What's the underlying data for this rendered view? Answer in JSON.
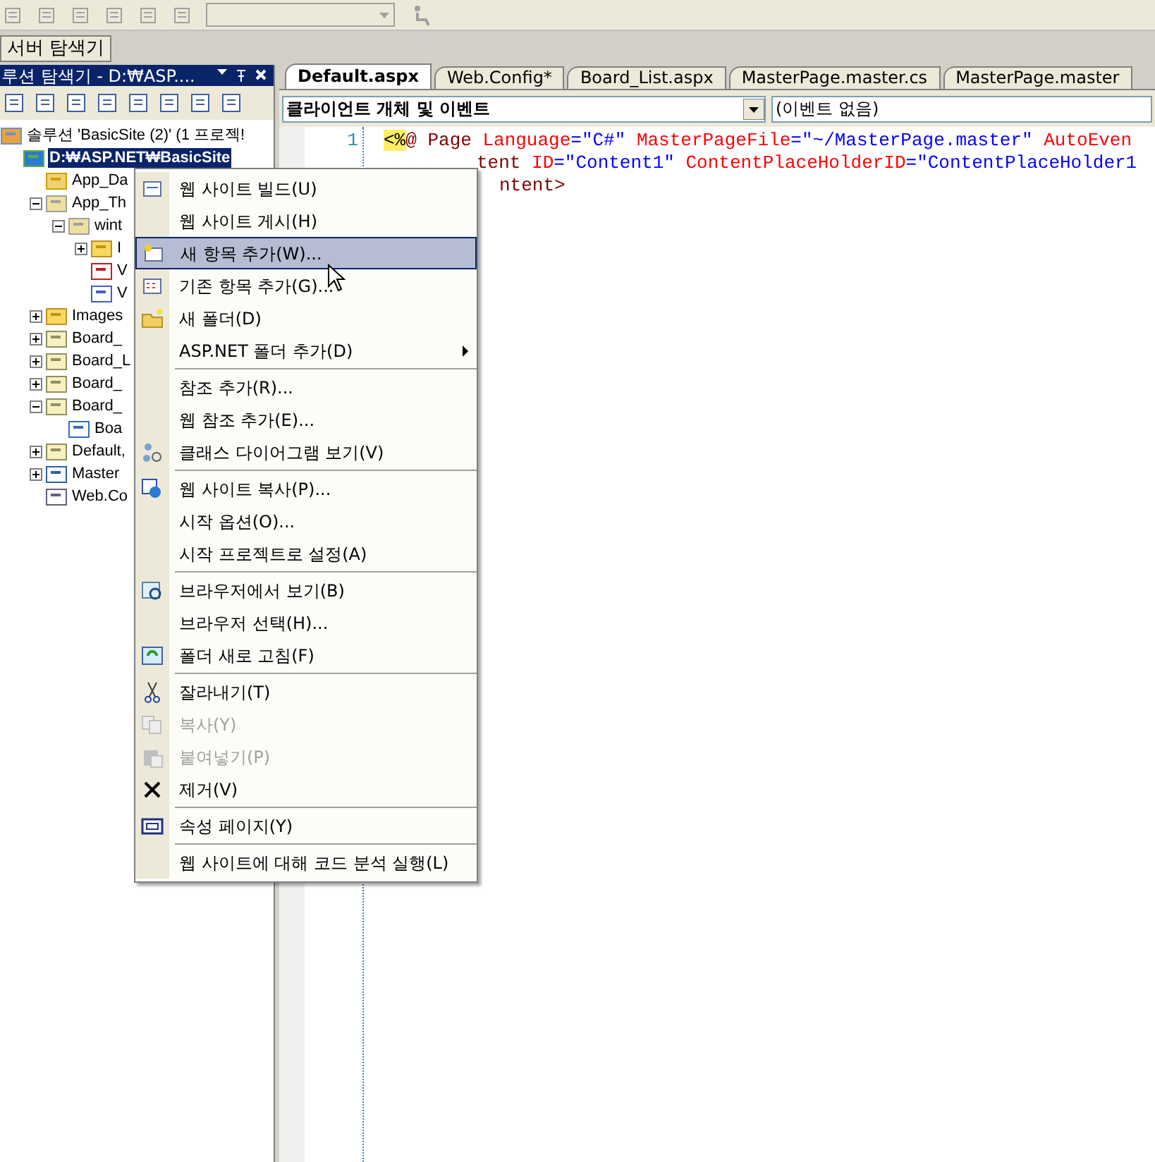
{
  "server_explorer_tab": {
    "label": "서버 탐색기"
  },
  "solution_explorer": {
    "title": "루션 탐색기 - D:₩ASP....",
    "tree": [
      {
        "label": "솔루션 'BasicSite (2)' (1 프로젝!",
        "kind": "solution",
        "selected": false,
        "children": [
          {
            "label": "D:₩ASP.NET₩BasicSite",
            "kind": "web",
            "selected": true,
            "children": [
              {
                "label": "App_Da",
                "kind": "datafolder",
                "selected": false
              },
              {
                "label": "App_Th",
                "kind": "openfolder",
                "selected": false,
                "expanded": true,
                "children": [
                  {
                    "label": "wint",
                    "kind": "openfolder",
                    "selected": false,
                    "expanded": true,
                    "children": [
                      {
                        "label": "I",
                        "kind": "folder",
                        "selected": false,
                        "expanded": false
                      },
                      {
                        "label": "V",
                        "kind": "skin",
                        "selected": false
                      },
                      {
                        "label": "V",
                        "kind": "css",
                        "selected": false
                      }
                    ]
                  }
                ]
              },
              {
                "label": "Images",
                "kind": "folder",
                "selected": false,
                "expanded": false
              },
              {
                "label": "Board_",
                "kind": "page",
                "selected": false,
                "expanded": false
              },
              {
                "label": "Board_L",
                "kind": "page",
                "selected": false,
                "expanded": false
              },
              {
                "label": "Board_",
                "kind": "page",
                "selected": false,
                "expanded": false
              },
              {
                "label": "Board_",
                "kind": "page",
                "selected": false,
                "expanded": true,
                "children": [
                  {
                    "label": "Boa",
                    "kind": "code",
                    "selected": false
                  }
                ]
              },
              {
                "label": "Default,",
                "kind": "page",
                "selected": false,
                "expanded": false
              },
              {
                "label": "Master",
                "kind": "master",
                "selected": false,
                "expanded": false
              },
              {
                "label": "Web.Co",
                "kind": "config",
                "selected": false
              }
            ]
          }
        ]
      }
    ]
  },
  "editor": {
    "tabs": [
      {
        "label": "Default.aspx",
        "selected": true
      },
      {
        "label": "Web.Config*",
        "selected": false
      },
      {
        "label": "Board_List.aspx",
        "selected": false
      },
      {
        "label": "MasterPage.master.cs",
        "selected": false
      },
      {
        "label": "MasterPage.master",
        "selected": false
      }
    ],
    "object_dropdown": {
      "value": "클라이언트 개체 및 이벤트"
    },
    "event_dropdown": {
      "value": "(이벤트 없음)"
    },
    "lines": [
      {
        "number": "1",
        "tokens": [
          {
            "kind": "delim",
            "text": "<%"
          },
          {
            "kind": "tag",
            "text": "@ Page "
          },
          {
            "kind": "attr",
            "text": "Language"
          },
          {
            "kind": "value",
            "text": "=\"C#\" "
          },
          {
            "kind": "attr",
            "text": "MasterPageFile"
          },
          {
            "kind": "value",
            "text": "=\"~/MasterPage.master\" "
          },
          {
            "kind": "attr",
            "text": "AutoEven"
          }
        ]
      },
      {
        "tokens": [
          {
            "kind": "tag",
            "text": "tent "
          },
          {
            "kind": "attr",
            "text": "ID"
          },
          {
            "kind": "value",
            "text": "=\"Content1\" "
          },
          {
            "kind": "attr",
            "text": "ContentPlaceHolderID"
          },
          {
            "kind": "value",
            "text": "=\"ContentPlaceHolder1"
          }
        ]
      },
      {
        "tokens": [
          {
            "kind": "tag",
            "text": "ntent>"
          }
        ]
      }
    ]
  },
  "context_menu": {
    "items": [
      {
        "kind": "item",
        "label": "웹 사이트 빌드(U)",
        "selected": false,
        "disabled": false
      },
      {
        "kind": "item",
        "label": "웹 사이트 게시(H)",
        "selected": false,
        "disabled": false
      },
      {
        "kind": "item",
        "label": "새 항목 추가(W)...",
        "selected": true,
        "disabled": false
      },
      {
        "kind": "item",
        "label": "기존 항목 추가(G)...",
        "selected": false,
        "disabled": false
      },
      {
        "kind": "item",
        "label": "새 폴더(D)",
        "selected": false,
        "disabled": false
      },
      {
        "kind": "item",
        "label": "ASP.NET 폴더 추가(D)",
        "selected": false,
        "disabled": false,
        "submenu": true
      },
      {
        "kind": "separator"
      },
      {
        "kind": "item",
        "label": "참조 추가(R)...",
        "selected": false,
        "disabled": false
      },
      {
        "kind": "item",
        "label": "웹 참조 추가(E)...",
        "selected": false,
        "disabled": false
      },
      {
        "kind": "item",
        "label": "클래스 다이어그램 보기(V)",
        "selected": false,
        "disabled": false
      },
      {
        "kind": "separator"
      },
      {
        "kind": "item",
        "label": "웹 사이트 복사(P)...",
        "selected": false,
        "disabled": false
      },
      {
        "kind": "item",
        "label": "시작 옵션(O)...",
        "selected": false,
        "disabled": false
      },
      {
        "kind": "item",
        "label": "시작 프로젝트로 설정(A)",
        "selected": false,
        "disabled": false
      },
      {
        "kind": "separator"
      },
      {
        "kind": "item",
        "label": "브라우저에서 보기(B)",
        "selected": false,
        "disabled": false
      },
      {
        "kind": "item",
        "label": "브라우저 선택(H)...",
        "selected": false,
        "disabled": false
      },
      {
        "kind": "item",
        "label": "폴더 새로 고침(F)",
        "selected": false,
        "disabled": false
      },
      {
        "kind": "separator"
      },
      {
        "kind": "item",
        "label": "잘라내기(T)",
        "selected": false,
        "disabled": false
      },
      {
        "kind": "item",
        "label": "복사(Y)",
        "selected": false,
        "disabled": true
      },
      {
        "kind": "item",
        "label": "붙여넣기(P)",
        "selected": false,
        "disabled": true
      },
      {
        "kind": "item",
        "label": "제거(V)",
        "selected": false,
        "disabled": false
      },
      {
        "kind": "separator"
      },
      {
        "kind": "item",
        "label": "속성 페이지(Y)",
        "selected": false,
        "disabled": false
      },
      {
        "kind": "separator"
      },
      {
        "kind": "item",
        "label": "웹 사이트에 대해 코드 분석 실행(L)",
        "selected": false,
        "disabled": false
      }
    ]
  }
}
